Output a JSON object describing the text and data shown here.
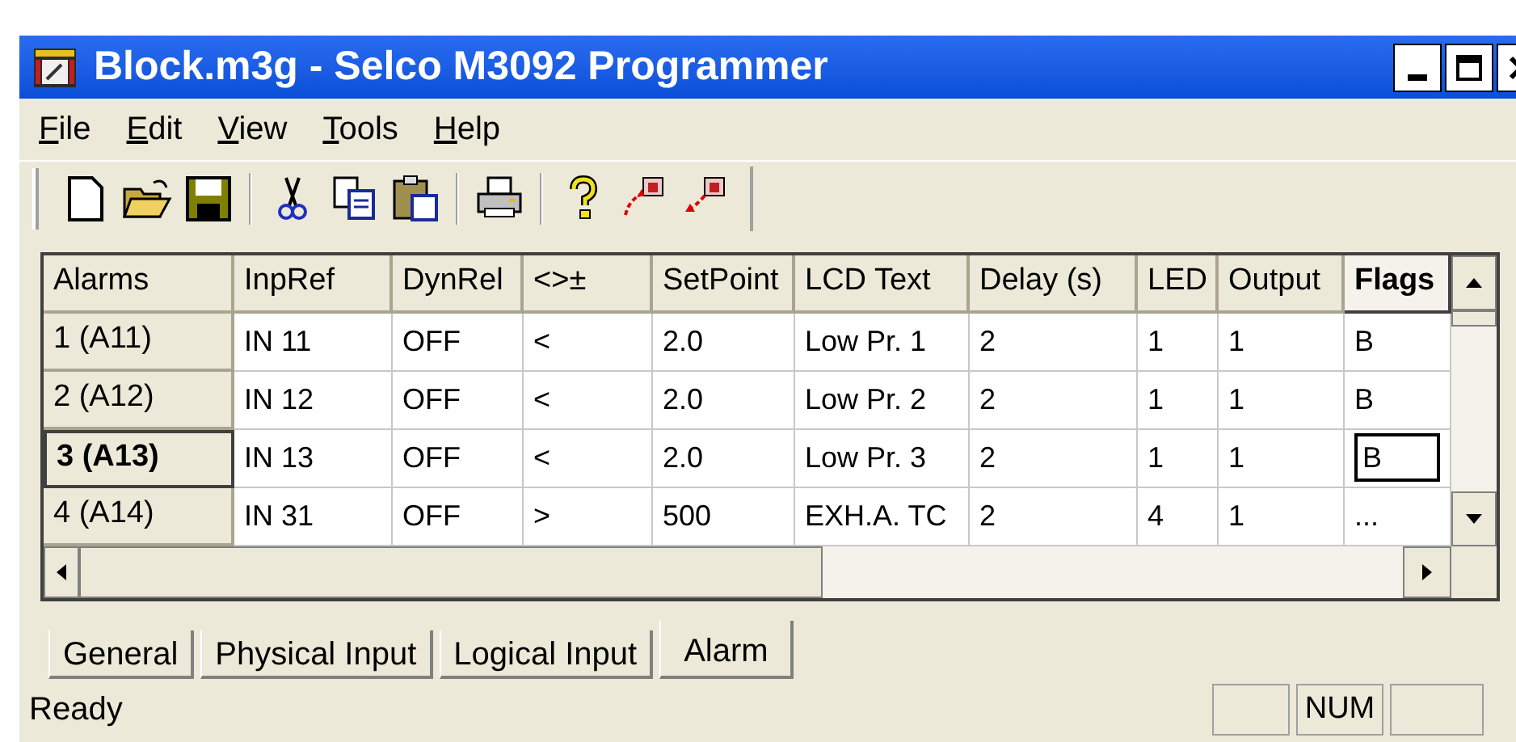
{
  "window": {
    "title": "Block.m3g - Selco M3092 Programmer"
  },
  "menu": [
    {
      "label": "File"
    },
    {
      "label": "Edit"
    },
    {
      "label": "View"
    },
    {
      "label": "Tools"
    },
    {
      "label": "Help"
    }
  ],
  "table": {
    "columns": [
      {
        "label": "Alarms",
        "selected": false
      },
      {
        "label": "InpRef",
        "selected": false
      },
      {
        "label": "DynRel",
        "selected": false
      },
      {
        "label": "<>±",
        "selected": false
      },
      {
        "label": "SetPoint",
        "selected": false
      },
      {
        "label": "LCD Text",
        "selected": false
      },
      {
        "label": "Delay (s)",
        "selected": false
      },
      {
        "label": "LED",
        "selected": false
      },
      {
        "label": "Output",
        "selected": false
      },
      {
        "label": "Flags",
        "selected": true
      }
    ],
    "rows": [
      {
        "selected": false,
        "cells": [
          "1 (A11)",
          "IN 11",
          "OFF",
          "<",
          "2.0",
          "Low Pr. 1",
          "2",
          "1",
          "1",
          "B"
        ]
      },
      {
        "selected": false,
        "cells": [
          "2 (A12)",
          "IN 12",
          "OFF",
          "<",
          "2.0",
          "Low Pr. 2",
          "2",
          "1",
          "1",
          "B"
        ]
      },
      {
        "selected": true,
        "cells": [
          "3 (A13)",
          "IN 13",
          "OFF",
          "<",
          "2.0",
          "Low Pr. 3",
          "2",
          "1",
          "1",
          "B"
        ]
      },
      {
        "selected": false,
        "cells": [
          "4 (A14)",
          "IN 31",
          "OFF",
          ">",
          "500",
          "EXH.A. TC",
          "2",
          "4",
          "1",
          "..."
        ]
      }
    ]
  },
  "tabs": [
    {
      "label": "General",
      "selected": false
    },
    {
      "label": "Physical Input",
      "selected": false
    },
    {
      "label": "Logical Input",
      "selected": false
    },
    {
      "label": "Alarm",
      "selected": true
    }
  ],
  "status_bar": {
    "text": "Ready",
    "indicator": "NUM"
  }
}
